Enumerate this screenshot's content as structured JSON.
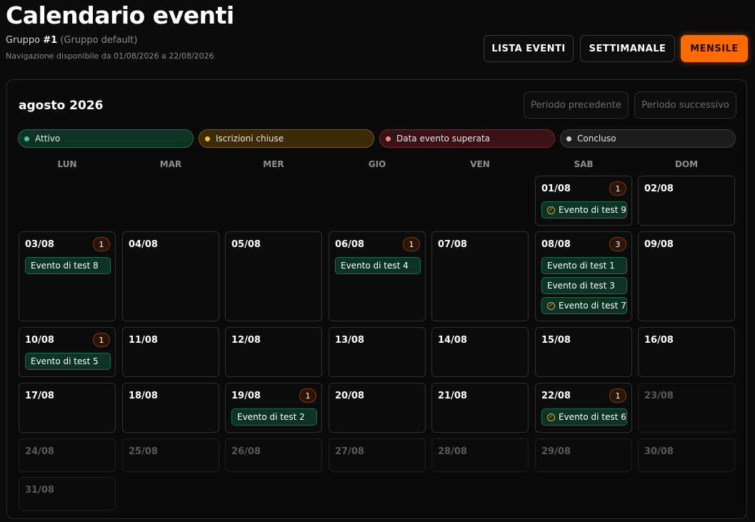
{
  "header": {
    "title": "Calendario eventi",
    "group_prefix": "Gruppo ",
    "group_number": "#1",
    "group_name": " (Gruppo default)",
    "nav_range": "Navigazione disponibile da 01/08/2026 a 22/08/2026"
  },
  "views": [
    "LISTA EVENTI",
    "SETTIMANALE",
    "MENSILE"
  ],
  "active_view": "MENSILE",
  "calendar": {
    "month_label": "agosto 2026",
    "prev_label": "Periodo precedente",
    "next_label": "Periodo successivo",
    "legend": [
      {
        "label": "Attivo",
        "dot": "#3ecf8e",
        "bg": "#0e3325",
        "border": "#1f6a48"
      },
      {
        "label": "Iscrizioni chiuse",
        "dot": "#f2c230",
        "bg": "#3a2a06",
        "border": "#7a5a12"
      },
      {
        "label": "Data evento superata",
        "dot": "#f08a8a",
        "bg": "#3a1216",
        "border": "#73262d"
      },
      {
        "label": "Concluso",
        "dot": "#d0d0d0",
        "bg": "#1d1d1d",
        "border": "#3a3a3a"
      }
    ],
    "weekdays": [
      "LUN",
      "MAR",
      "MER",
      "GIO",
      "VEN",
      "SAB",
      "DOM"
    ],
    "weeks": [
      [
        null,
        null,
        null,
        null,
        null,
        {
          "date": "01/08",
          "count": "1",
          "events": [
            {
              "name": "Evento di test 9",
              "icon": "check-circle-icon"
            }
          ]
        },
        {
          "date": "02/08",
          "events": []
        }
      ],
      [
        {
          "date": "03/08",
          "count": "1",
          "events": [
            {
              "name": "Evento di test 8"
            }
          ]
        },
        {
          "date": "04/08",
          "events": []
        },
        {
          "date": "05/08",
          "events": []
        },
        {
          "date": "06/08",
          "count": "1",
          "events": [
            {
              "name": "Evento di test 4"
            }
          ]
        },
        {
          "date": "07/08",
          "events": []
        },
        {
          "date": "08/08",
          "count": "3",
          "events": [
            {
              "name": "Evento di test 1"
            },
            {
              "name": "Evento di test 3"
            },
            {
              "name": "Evento di test 7",
              "icon": "check-circle-icon"
            }
          ]
        },
        {
          "date": "09/08",
          "events": []
        }
      ],
      [
        {
          "date": "10/08",
          "count": "1",
          "events": [
            {
              "name": "Evento di test 5"
            }
          ]
        },
        {
          "date": "11/08",
          "events": []
        },
        {
          "date": "12/08",
          "events": []
        },
        {
          "date": "13/08",
          "events": []
        },
        {
          "date": "14/08",
          "events": []
        },
        {
          "date": "15/08",
          "events": []
        },
        {
          "date": "16/08",
          "events": []
        }
      ],
      [
        {
          "date": "17/08",
          "events": []
        },
        {
          "date": "18/08",
          "events": []
        },
        {
          "date": "19/08",
          "count": "1",
          "events": [
            {
              "name": "Evento di test 2"
            }
          ]
        },
        {
          "date": "20/08",
          "events": []
        },
        {
          "date": "21/08",
          "events": []
        },
        {
          "date": "22/08",
          "count": "1",
          "events": [
            {
              "name": "Evento di test 6",
              "icon": "check-circle-icon"
            }
          ]
        },
        {
          "date": "23/08",
          "disabled": true,
          "events": []
        }
      ],
      [
        {
          "date": "24/08",
          "disabled": true,
          "events": []
        },
        {
          "date": "25/08",
          "disabled": true,
          "events": []
        },
        {
          "date": "26/08",
          "disabled": true,
          "events": []
        },
        {
          "date": "27/08",
          "disabled": true,
          "events": []
        },
        {
          "date": "28/08",
          "disabled": true,
          "events": []
        },
        {
          "date": "29/08",
          "disabled": true,
          "events": []
        },
        {
          "date": "30/08",
          "disabled": true,
          "events": []
        }
      ],
      [
        {
          "date": "31/08",
          "disabled": true,
          "events": []
        },
        null,
        null,
        null,
        null,
        null,
        null
      ]
    ]
  }
}
